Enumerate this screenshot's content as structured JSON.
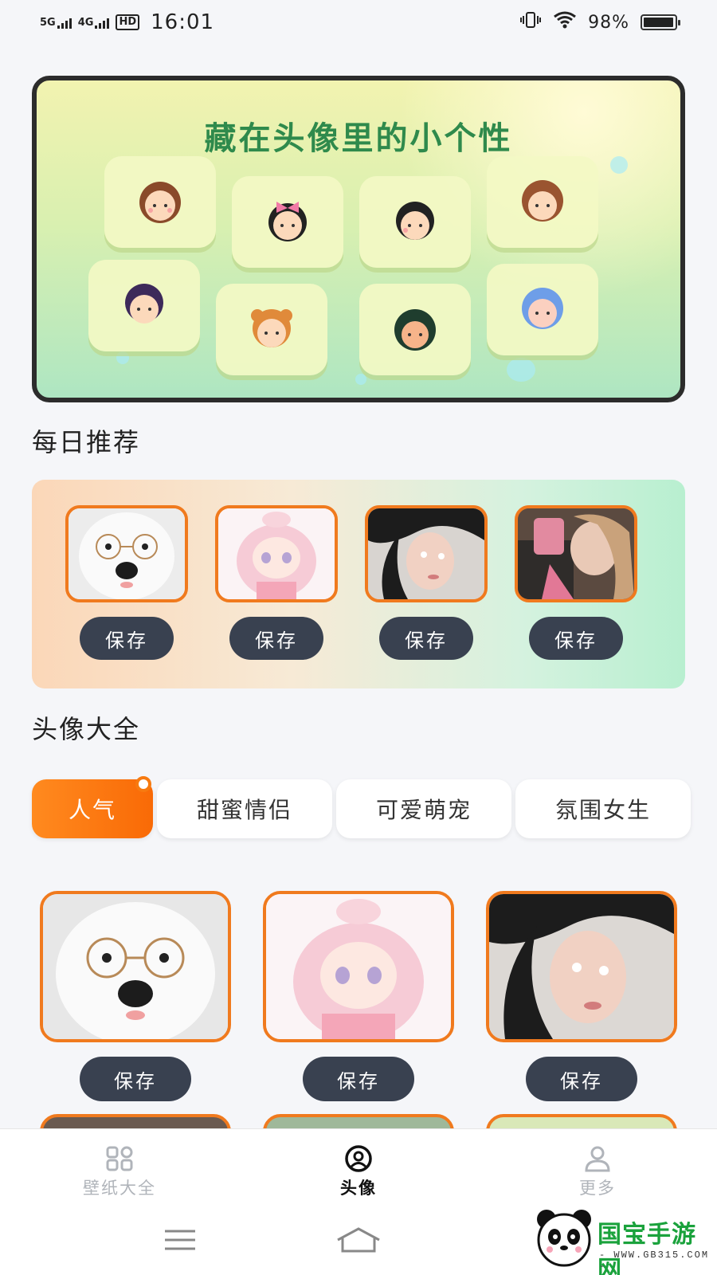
{
  "status_bar": {
    "net1": "5G",
    "net2": "4G",
    "hd": "HD",
    "time": "16:01",
    "battery_text": "98%",
    "battery_level": 0.98
  },
  "banner": {
    "title": "藏在头像里的小个性"
  },
  "daily": {
    "title": "每日推荐",
    "items": [
      {
        "subject": "samoyed-with-glasses",
        "save_label": "保存"
      },
      {
        "subject": "anime-girl-pink",
        "save_label": "保存"
      },
      {
        "subject": "girl-lying-portrait",
        "save_label": "保存"
      },
      {
        "subject": "girl-selfie",
        "save_label": "保存"
      }
    ]
  },
  "gallery": {
    "title": "头像大全",
    "tabs": [
      {
        "label": "人气",
        "active": true
      },
      {
        "label": "甜蜜情侣",
        "active": false
      },
      {
        "label": "可爱萌宠",
        "active": false
      },
      {
        "label": "氛围女生",
        "active": false
      }
    ],
    "items": [
      {
        "subject": "samoyed-with-glasses",
        "save_label": "保存"
      },
      {
        "subject": "anime-girl-pink",
        "save_label": "保存"
      },
      {
        "subject": "girl-lying-portrait",
        "save_label": "保存"
      }
    ]
  },
  "bottom_nav": [
    {
      "label": "壁纸大全",
      "icon": "grid-icon",
      "active": false
    },
    {
      "label": "头像",
      "icon": "avatar-icon",
      "active": true
    },
    {
      "label": "更多",
      "icon": "user-icon",
      "active": false
    }
  ],
  "watermark": {
    "text": "国宝手游网",
    "url": "- WWW.GB315.COM -"
  },
  "colors": {
    "accent": "#f77a10",
    "button": "#394150"
  }
}
